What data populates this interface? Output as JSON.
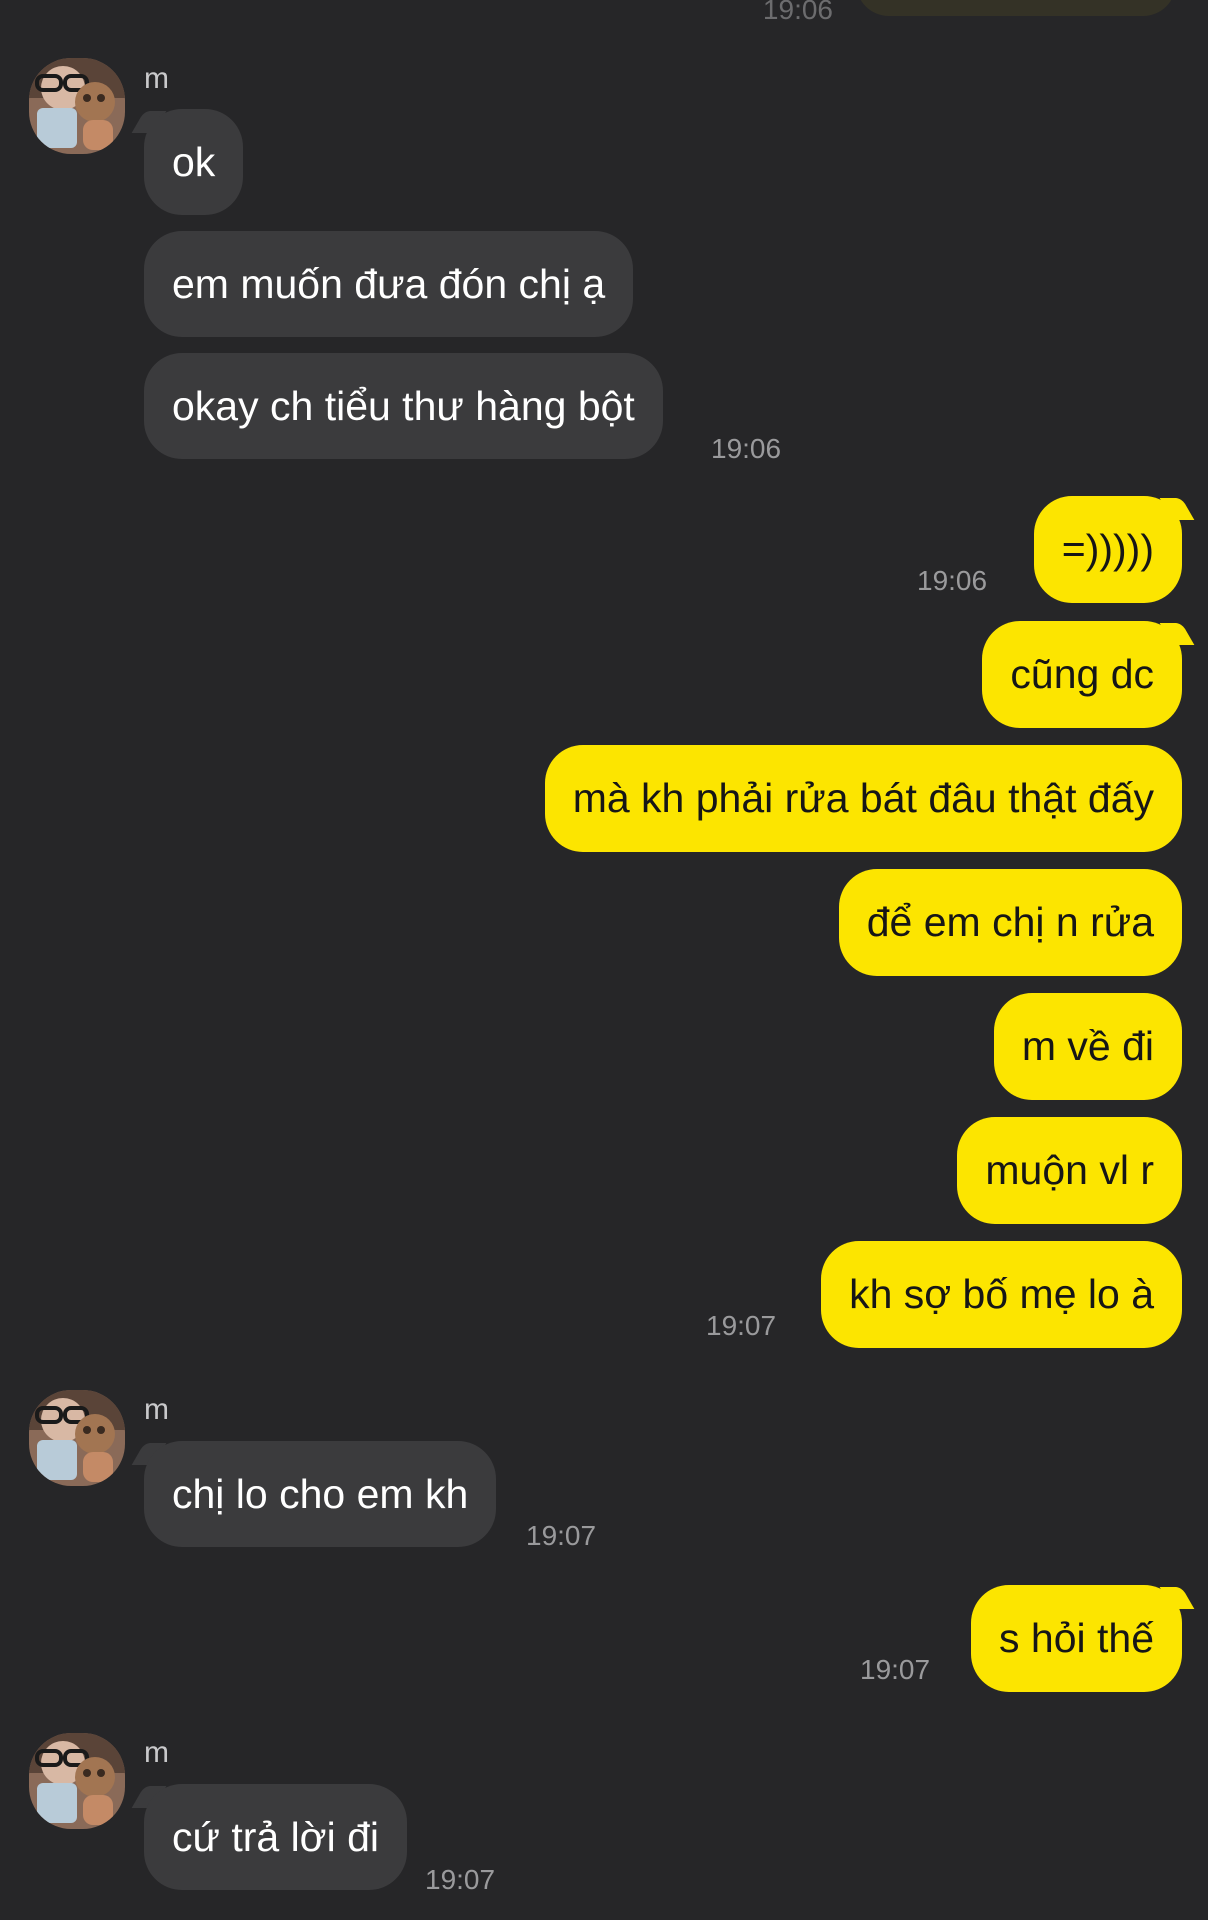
{
  "chat": {
    "sender_name": "m",
    "partial_time": "19:06",
    "messages": [
      {
        "text": "ok"
      },
      {
        "text": "em muốn đưa đón chị ạ"
      },
      {
        "text": "okay ch tiểu thư hàng bột",
        "time": "19:06"
      },
      {
        "text": "=)))))",
        "time": "19:06"
      },
      {
        "text": "cũng dc"
      },
      {
        "text": "mà kh phải rửa bát đâu thật đấy"
      },
      {
        "text": "để em chị n rửa"
      },
      {
        "text": "m về đi"
      },
      {
        "text": "muộn vl r"
      },
      {
        "text": "kh sợ bố mẹ lo à",
        "time": "19:07"
      },
      {
        "text": "chị lo cho em kh",
        "time": "19:07"
      },
      {
        "text": "s hỏi thế",
        "time": "19:07"
      },
      {
        "text": "cứ trả lời đi",
        "time": "19:07"
      }
    ]
  },
  "colors": {
    "background": "#262628",
    "incoming_bubble": "#3b3b3d",
    "outgoing_bubble": "#fce500",
    "timestamp": "#9a9a9c"
  }
}
